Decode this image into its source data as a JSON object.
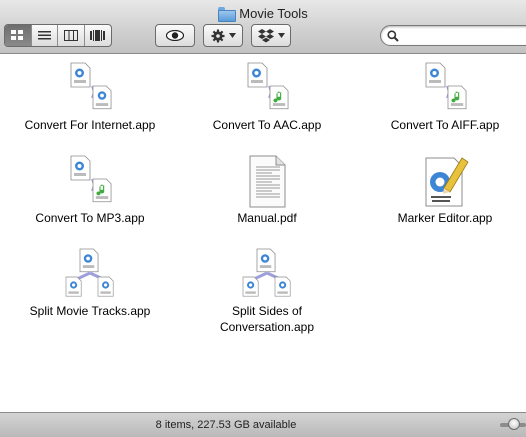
{
  "window": {
    "title": "Movie Tools"
  },
  "toolbar": {
    "view_buttons": [
      {
        "name": "view-icons-button",
        "icon": "icon-grid-icon",
        "active": true
      },
      {
        "name": "view-list-button",
        "icon": "list-icon",
        "active": false
      },
      {
        "name": "view-columns-button",
        "icon": "columns-icon",
        "active": false
      },
      {
        "name": "view-coverflow-button",
        "icon": "coverflow-icon",
        "active": false
      }
    ],
    "quicklook_icon": "eye-icon",
    "action_icon": "gear-icon",
    "dropbox_icon": "dropbox-icon",
    "search": {
      "value": "",
      "placeholder": ""
    }
  },
  "files": [
    {
      "label": "Convert For Internet.app",
      "kind": "convert",
      "badge": ""
    },
    {
      "label": "Convert To AAC.app",
      "kind": "convert-audio",
      "badge": "MPEG4"
    },
    {
      "label": "Convert To AIFF.app",
      "kind": "convert-audio",
      "badge": "AIFF"
    },
    {
      "label": "Convert To MP3.app",
      "kind": "convert-audio",
      "badge": "MP3"
    },
    {
      "label": "Manual.pdf",
      "kind": "pdf",
      "badge": ""
    },
    {
      "label": "Marker Editor.app",
      "kind": "marker",
      "badge": "MARKER EDITOR"
    },
    {
      "label": "Split Movie Tracks.app",
      "kind": "split",
      "badge": ""
    },
    {
      "label": "Split Sides of Conversation.app",
      "kind": "split",
      "badge": ""
    }
  ],
  "status": {
    "text": "8 items, 227.53 GB available"
  },
  "colors": {
    "accent": "#4a84bd",
    "arrow": "#8d8fd6",
    "status_bg": "#c8c8c8"
  }
}
